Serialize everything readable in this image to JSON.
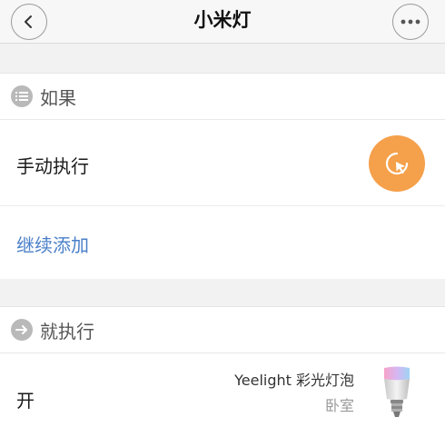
{
  "nav": {
    "title": "小米灯",
    "back_icon": "chevron-left-icon",
    "more_icon": "more-dots-icon"
  },
  "if_section": {
    "title": "如果",
    "icon": "list-icon"
  },
  "condition": {
    "label": "手动执行",
    "button_icon": "tap-cursor-icon",
    "button_color": "#f5a04a"
  },
  "add_more": {
    "label": "继续添加",
    "color": "#4a7fc8"
  },
  "then_section": {
    "title": "就执行",
    "icon": "arrow-right-icon"
  },
  "action": {
    "label": "开",
    "device_name": "Yeelight 彩光灯泡",
    "device_room": "卧室",
    "device_icon": "color-bulb-icon"
  }
}
